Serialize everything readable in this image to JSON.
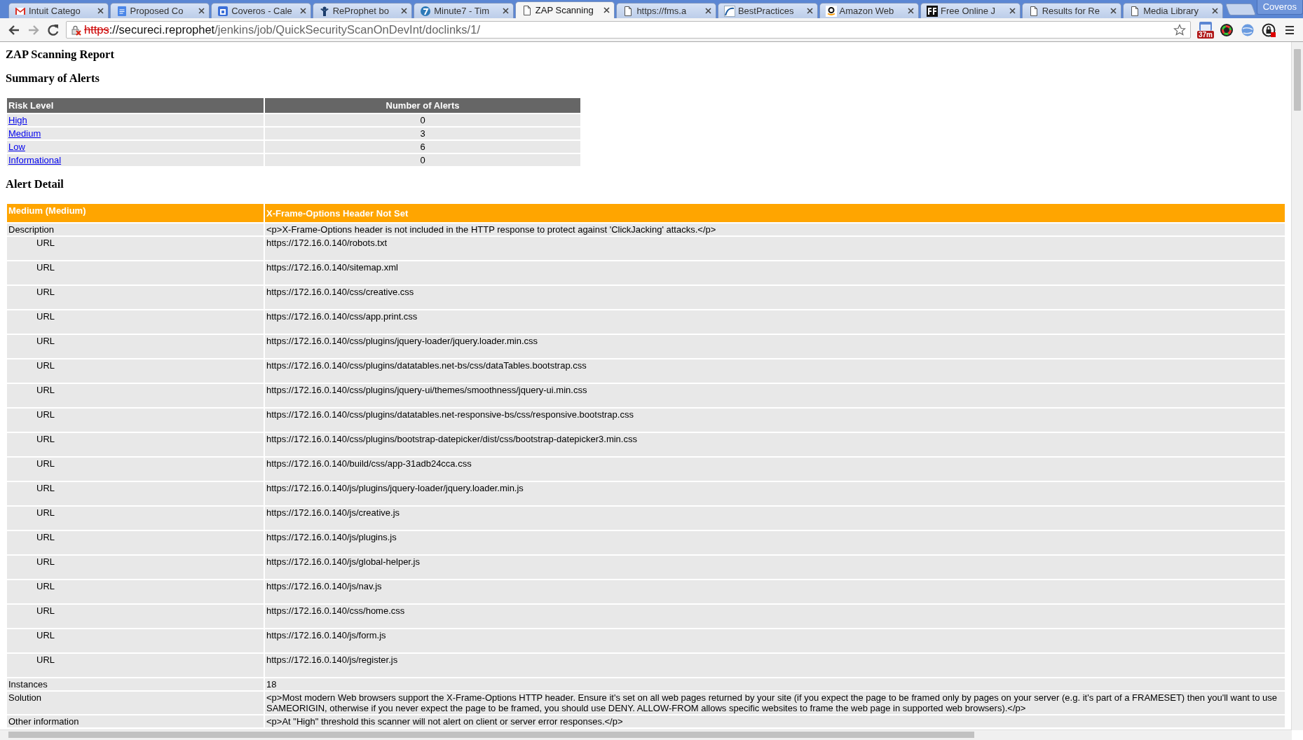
{
  "browser": {
    "tabs": [
      {
        "title": "Intuit Catego",
        "selected": false
      },
      {
        "title": "Proposed Co",
        "selected": false
      },
      {
        "title": "Coveros - Cale",
        "selected": false
      },
      {
        "title": "ReProphet bo",
        "selected": false
      },
      {
        "title": "Minute7 - Tim",
        "selected": false
      },
      {
        "title": "ZAP Scanning",
        "selected": true
      },
      {
        "title": "https://fms.a",
        "selected": false
      },
      {
        "title": "BestPractices",
        "selected": false
      },
      {
        "title": "Amazon Web",
        "selected": false
      },
      {
        "title": "Free Online J",
        "selected": false
      },
      {
        "title": "Results for Re",
        "selected": false
      },
      {
        "title": "Media Library",
        "selected": false
      }
    ],
    "profile": "Coveros",
    "address": {
      "insecure": true,
      "scheme": "https",
      "host": "://secureci.reprophet",
      "path": "/jenkins/job/QuickSecurityScanOnDevInt/doclinks/1/"
    },
    "extension_badge": "37m"
  },
  "report": {
    "title": "ZAP Scanning Report",
    "summary_heading": "Summary of Alerts",
    "summary_table": {
      "columns": [
        "Risk Level",
        "Number of Alerts"
      ],
      "rows": [
        {
          "level": "High",
          "count": "0"
        },
        {
          "level": "Medium",
          "count": "3"
        },
        {
          "level": "Low",
          "count": "6"
        },
        {
          "level": "Informational",
          "count": "0"
        }
      ]
    },
    "detail_heading": "Alert Detail",
    "alert": {
      "risk": "Medium (Medium)",
      "name": "X-Frame-Options Header Not Set",
      "rows": [
        {
          "kind": "field",
          "label": "Description",
          "value": "<p>X-Frame-Options header is not included in the HTTP response to protect against 'ClickJacking' attacks.</p>"
        },
        {
          "kind": "url",
          "label": "URL",
          "value": "https://172.16.0.140/robots.txt"
        },
        {
          "kind": "url",
          "label": "URL",
          "value": "https://172.16.0.140/sitemap.xml"
        },
        {
          "kind": "url",
          "label": "URL",
          "value": "https://172.16.0.140/css/creative.css"
        },
        {
          "kind": "url",
          "label": "URL",
          "value": "https://172.16.0.140/css/app.print.css"
        },
        {
          "kind": "url",
          "label": "URL",
          "value": "https://172.16.0.140/css/plugins/jquery-loader/jquery.loader.min.css"
        },
        {
          "kind": "url",
          "label": "URL",
          "value": "https://172.16.0.140/css/plugins/datatables.net-bs/css/dataTables.bootstrap.css"
        },
        {
          "kind": "url",
          "label": "URL",
          "value": "https://172.16.0.140/css/plugins/jquery-ui/themes/smoothness/jquery-ui.min.css"
        },
        {
          "kind": "url",
          "label": "URL",
          "value": "https://172.16.0.140/css/plugins/datatables.net-responsive-bs/css/responsive.bootstrap.css"
        },
        {
          "kind": "url",
          "label": "URL",
          "value": "https://172.16.0.140/css/plugins/bootstrap-datepicker/dist/css/bootstrap-datepicker3.min.css"
        },
        {
          "kind": "url",
          "label": "URL",
          "value": "https://172.16.0.140/build/css/app-31adb24cca.css"
        },
        {
          "kind": "url",
          "label": "URL",
          "value": "https://172.16.0.140/js/plugins/jquery-loader/jquery.loader.min.js"
        },
        {
          "kind": "url",
          "label": "URL",
          "value": "https://172.16.0.140/js/creative.js"
        },
        {
          "kind": "url",
          "label": "URL",
          "value": "https://172.16.0.140/js/plugins.js"
        },
        {
          "kind": "url",
          "label": "URL",
          "value": "https://172.16.0.140/js/global-helper.js"
        },
        {
          "kind": "url",
          "label": "URL",
          "value": "https://172.16.0.140/js/nav.js"
        },
        {
          "kind": "url",
          "label": "URL",
          "value": "https://172.16.0.140/css/home.css"
        },
        {
          "kind": "url",
          "label": "URL",
          "value": "https://172.16.0.140/js/form.js"
        },
        {
          "kind": "url",
          "label": "URL",
          "value": "https://172.16.0.140/js/register.js"
        },
        {
          "kind": "field",
          "label": "Instances",
          "value": "18"
        },
        {
          "kind": "field",
          "label": "Solution",
          "value": "<p>Most modern Web browsers support the X-Frame-Options HTTP header. Ensure it's set on all web pages returned by your site (if you expect the page to be framed only by pages on your server (e.g. it's part of a FRAMESET) then you'll want to use SAMEORIGIN, otherwise if you never expect the page to be framed, you should use DENY. ALLOW-FROM allows specific websites to frame the web page in supported web browsers).</p>"
        },
        {
          "kind": "field",
          "label": "Other information",
          "value": "<p>At \"High\" threshold this scanner will not alert on client or server error responses.</p>"
        }
      ]
    }
  }
}
